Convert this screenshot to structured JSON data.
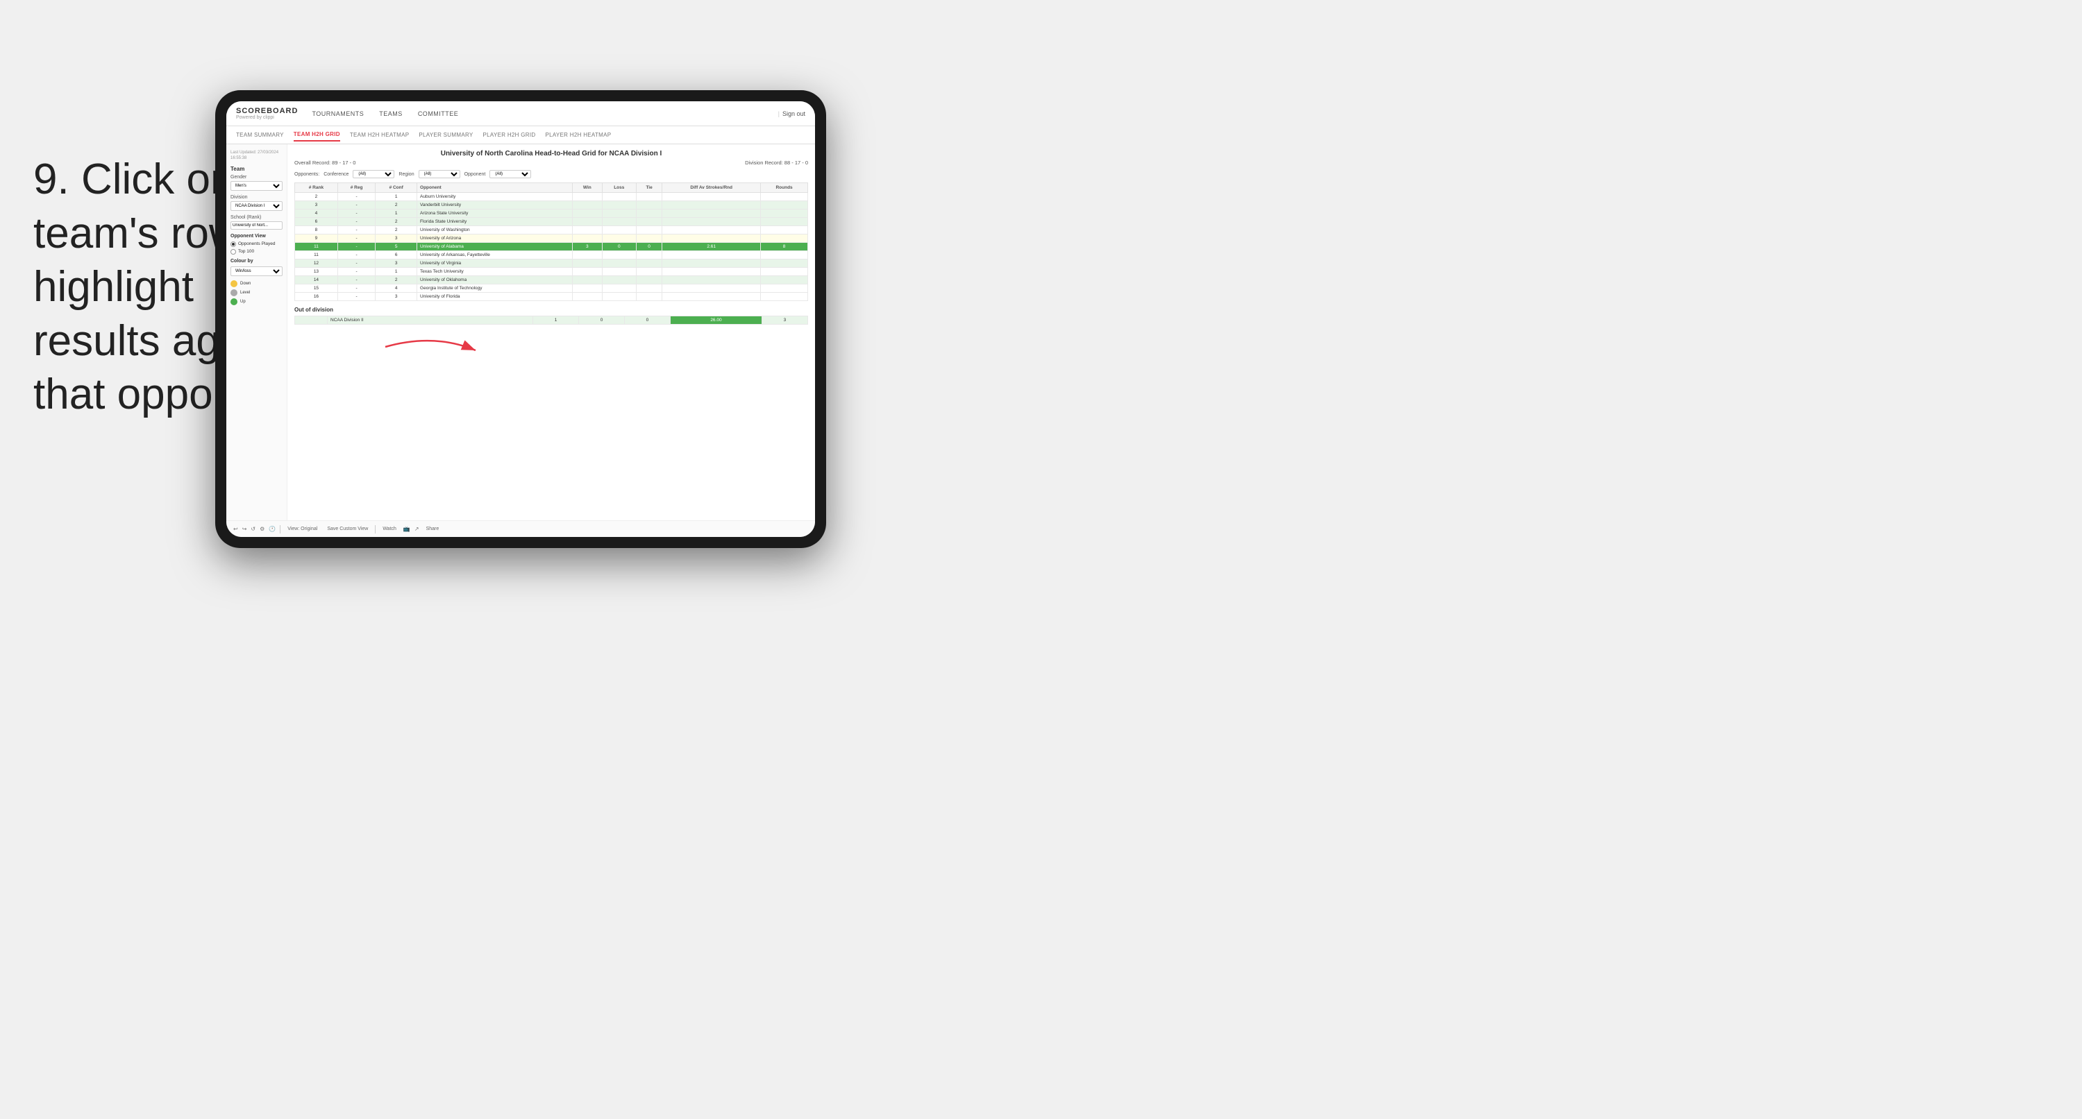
{
  "instruction": {
    "step": "9.",
    "text": "Click on a team's row to highlight results against that opponent"
  },
  "nav": {
    "logo": "SCOREBOARD",
    "powered_by": "Powered by clippi",
    "items": [
      "TOURNAMENTS",
      "TEAMS",
      "COMMITTEE"
    ],
    "sign_out": "Sign out"
  },
  "sub_nav": {
    "items": [
      {
        "label": "TEAM SUMMARY",
        "active": false
      },
      {
        "label": "TEAM H2H GRID",
        "active": true
      },
      {
        "label": "TEAM H2H HEATMAP",
        "active": false
      },
      {
        "label": "PLAYER SUMMARY",
        "active": false
      },
      {
        "label": "PLAYER H2H GRID",
        "active": false
      },
      {
        "label": "PLAYER H2H HEATMAP",
        "active": false
      }
    ]
  },
  "sidebar": {
    "last_updated": "Last Updated: 27/03/2024\n16:55:38",
    "team_label": "Team",
    "gender_label": "Gender",
    "gender_value": "Men's",
    "division_label": "Division",
    "division_value": "NCAA Division I",
    "school_rank_label": "School (Rank)",
    "school_rank_value": "University of Nort...",
    "opponent_view_title": "Opponent View",
    "opponents_played": "Opponents Played",
    "top100": "Top 100",
    "colour_by_title": "Colour by",
    "colour_by_value": "Win/loss",
    "legend": [
      {
        "color": "#f4c542",
        "label": "Down"
      },
      {
        "color": "#aaaaaa",
        "label": "Level"
      },
      {
        "color": "#4caf50",
        "label": "Up"
      }
    ]
  },
  "grid": {
    "title": "University of North Carolina Head-to-Head Grid for NCAA Division I",
    "overall_record": "Overall Record: 89 - 17 - 0",
    "division_record": "Division Record: 88 - 17 - 0",
    "filters": {
      "conference_label": "Conference",
      "conference_value": "(All)",
      "region_label": "Region",
      "region_value": "(All)",
      "opponent_label": "Opponent",
      "opponent_value": "(All)",
      "opponents_label": "Opponents:"
    },
    "columns": [
      "# Rank",
      "# Reg",
      "# Conf",
      "Opponent",
      "Win",
      "Loss",
      "Tie",
      "Diff Av Strokes/Rnd",
      "Rounds"
    ],
    "rows": [
      {
        "rank": "2",
        "reg": "-",
        "conf": "1",
        "opponent": "Auburn University",
        "win": "",
        "loss": "",
        "tie": "",
        "diff": "",
        "rounds": "",
        "style": "normal"
      },
      {
        "rank": "3",
        "reg": "-",
        "conf": "2",
        "opponent": "Vanderbilt University",
        "win": "",
        "loss": "",
        "tie": "",
        "diff": "",
        "rounds": "",
        "style": "light-green"
      },
      {
        "rank": "4",
        "reg": "-",
        "conf": "1",
        "opponent": "Arizona State University",
        "win": "",
        "loss": "",
        "tie": "",
        "diff": "",
        "rounds": "",
        "style": "light-green"
      },
      {
        "rank": "6",
        "reg": "-",
        "conf": "2",
        "opponent": "Florida State University",
        "win": "",
        "loss": "",
        "tie": "",
        "diff": "",
        "rounds": "",
        "style": "light-green"
      },
      {
        "rank": "8",
        "reg": "-",
        "conf": "2",
        "opponent": "University of Washington",
        "win": "",
        "loss": "",
        "tie": "",
        "diff": "",
        "rounds": "",
        "style": "normal"
      },
      {
        "rank": "9",
        "reg": "-",
        "conf": "3",
        "opponent": "University of Arizona",
        "win": "",
        "loss": "",
        "tie": "",
        "diff": "",
        "rounds": "",
        "style": "light-yellow"
      },
      {
        "rank": "11",
        "reg": "-",
        "conf": "5",
        "opponent": "University of Alabama",
        "win": "3",
        "loss": "0",
        "tie": "0",
        "diff": "2.61",
        "rounds": "8",
        "style": "highlighted"
      },
      {
        "rank": "11",
        "reg": "-",
        "conf": "6",
        "opponent": "University of Arkansas, Fayetteville",
        "win": "",
        "loss": "",
        "tie": "",
        "diff": "",
        "rounds": "",
        "style": "normal"
      },
      {
        "rank": "12",
        "reg": "-",
        "conf": "3",
        "opponent": "University of Virginia",
        "win": "",
        "loss": "",
        "tie": "",
        "diff": "",
        "rounds": "",
        "style": "light-green"
      },
      {
        "rank": "13",
        "reg": "-",
        "conf": "1",
        "opponent": "Texas Tech University",
        "win": "",
        "loss": "",
        "tie": "",
        "diff": "",
        "rounds": "",
        "style": "normal"
      },
      {
        "rank": "14",
        "reg": "-",
        "conf": "2",
        "opponent": "University of Oklahoma",
        "win": "",
        "loss": "",
        "tie": "",
        "diff": "",
        "rounds": "",
        "style": "light-green"
      },
      {
        "rank": "15",
        "reg": "-",
        "conf": "4",
        "opponent": "Georgia Institute of Technology",
        "win": "",
        "loss": "",
        "tie": "",
        "diff": "",
        "rounds": "",
        "style": "normal"
      },
      {
        "rank": "16",
        "reg": "-",
        "conf": "3",
        "opponent": "University of Florida",
        "win": "",
        "loss": "",
        "tie": "",
        "diff": "",
        "rounds": "",
        "style": "normal"
      }
    ],
    "out_of_division_title": "Out of division",
    "out_of_division_row": {
      "label": "NCAA Division II",
      "win": "1",
      "loss": "0",
      "tie": "0",
      "diff": "26.00",
      "rounds": "3"
    }
  },
  "toolbar": {
    "view_label": "View: Original",
    "save_custom_label": "Save Custom View",
    "watch_label": "Watch",
    "share_label": "Share"
  }
}
